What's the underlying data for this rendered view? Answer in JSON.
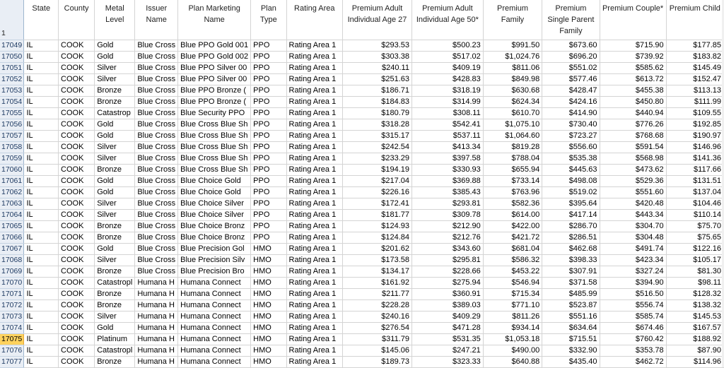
{
  "corner_row_label": "1",
  "columns": [
    "State",
    "County",
    "Metal Level",
    "Issuer Name",
    "Plan Marketing Name",
    "Plan Type",
    "Rating Area",
    "Premium Adult Individual Age 27",
    "Premium Adult Individual Age 50*",
    "Premium Family",
    "Premium Single Parent Family",
    "Premium Couple*",
    "Premium Child"
  ],
  "selected_row": "17075",
  "rows": [
    {
      "num": "17049",
      "cells": [
        "IL",
        "COOK",
        "Gold",
        "Blue Cross",
        "Blue PPO Gold 001",
        "PPO",
        "Rating Area 1",
        "$293.53",
        "$500.23",
        "$991.50",
        "$673.60",
        "$715.90",
        "$177.85"
      ]
    },
    {
      "num": "17050",
      "cells": [
        "IL",
        "COOK",
        "Gold",
        "Blue Cross",
        "Blue PPO Gold 002",
        "PPO",
        "Rating Area 1",
        "$303.38",
        "$517.02",
        "$1,024.76",
        "$696.20",
        "$739.92",
        "$183.82"
      ]
    },
    {
      "num": "17051",
      "cells": [
        "IL",
        "COOK",
        "Silver",
        "Blue Cross",
        "Blue PPO Silver 00",
        "PPO",
        "Rating Area 1",
        "$240.11",
        "$409.19",
        "$811.06",
        "$551.02",
        "$585.62",
        "$145.49"
      ]
    },
    {
      "num": "17052",
      "cells": [
        "IL",
        "COOK",
        "Silver",
        "Blue Cross",
        "Blue PPO Silver 00",
        "PPO",
        "Rating Area 1",
        "$251.63",
        "$428.83",
        "$849.98",
        "$577.46",
        "$613.72",
        "$152.47"
      ]
    },
    {
      "num": "17053",
      "cells": [
        "IL",
        "COOK",
        "Bronze",
        "Blue Cross",
        "Blue PPO Bronze (",
        "PPO",
        "Rating Area 1",
        "$186.71",
        "$318.19",
        "$630.68",
        "$428.47",
        "$455.38",
        "$113.13"
      ]
    },
    {
      "num": "17054",
      "cells": [
        "IL",
        "COOK",
        "Bronze",
        "Blue Cross",
        "Blue PPO Bronze (",
        "PPO",
        "Rating Area 1",
        "$184.83",
        "$314.99",
        "$624.34",
        "$424.16",
        "$450.80",
        "$111.99"
      ]
    },
    {
      "num": "17055",
      "cells": [
        "IL",
        "COOK",
        "Catastrop",
        "Blue Cross",
        "Blue Security PPO",
        "PPO",
        "Rating Area 1",
        "$180.79",
        "$308.11",
        "$610.70",
        "$414.90",
        "$440.94",
        "$109.55"
      ]
    },
    {
      "num": "17056",
      "cells": [
        "IL",
        "COOK",
        "Gold",
        "Blue Cross",
        "Blue Cross Blue Sh",
        "PPO",
        "Rating Area 1",
        "$318.28",
        "$542.41",
        "$1,075.10",
        "$730.40",
        "$776.26",
        "$192.85"
      ]
    },
    {
      "num": "17057",
      "cells": [
        "IL",
        "COOK",
        "Gold",
        "Blue Cross",
        "Blue Cross Blue Sh",
        "PPO",
        "Rating Area 1",
        "$315.17",
        "$537.11",
        "$1,064.60",
        "$723.27",
        "$768.68",
        "$190.97"
      ]
    },
    {
      "num": "17058",
      "cells": [
        "IL",
        "COOK",
        "Silver",
        "Blue Cross",
        "Blue Cross Blue Sh",
        "PPO",
        "Rating Area 1",
        "$242.54",
        "$413.34",
        "$819.28",
        "$556.60",
        "$591.54",
        "$146.96"
      ]
    },
    {
      "num": "17059",
      "cells": [
        "IL",
        "COOK",
        "Silver",
        "Blue Cross",
        "Blue Cross Blue Sh",
        "PPO",
        "Rating Area 1",
        "$233.29",
        "$397.58",
        "$788.04",
        "$535.38",
        "$568.98",
        "$141.36"
      ]
    },
    {
      "num": "17060",
      "cells": [
        "IL",
        "COOK",
        "Bronze",
        "Blue Cross",
        "Blue Cross Blue Sh",
        "PPO",
        "Rating Area 1",
        "$194.19",
        "$330.93",
        "$655.94",
        "$445.63",
        "$473.62",
        "$117.66"
      ]
    },
    {
      "num": "17061",
      "cells": [
        "IL",
        "COOK",
        "Gold",
        "Blue Cross",
        "Blue Choice Gold",
        "PPO",
        "Rating Area 1",
        "$217.04",
        "$369.88",
        "$733.14",
        "$498.08",
        "$529.36",
        "$131.51"
      ]
    },
    {
      "num": "17062",
      "cells": [
        "IL",
        "COOK",
        "Gold",
        "Blue Cross",
        "Blue Choice Gold",
        "PPO",
        "Rating Area 1",
        "$226.16",
        "$385.43",
        "$763.96",
        "$519.02",
        "$551.60",
        "$137.04"
      ]
    },
    {
      "num": "17063",
      "cells": [
        "IL",
        "COOK",
        "Silver",
        "Blue Cross",
        "Blue Choice Silver",
        "PPO",
        "Rating Area 1",
        "$172.41",
        "$293.81",
        "$582.36",
        "$395.64",
        "$420.48",
        "$104.46"
      ]
    },
    {
      "num": "17064",
      "cells": [
        "IL",
        "COOK",
        "Silver",
        "Blue Cross",
        "Blue Choice Silver",
        "PPO",
        "Rating Area 1",
        "$181.77",
        "$309.78",
        "$614.00",
        "$417.14",
        "$443.34",
        "$110.14"
      ]
    },
    {
      "num": "17065",
      "cells": [
        "IL",
        "COOK",
        "Bronze",
        "Blue Cross",
        "Blue Choice Bronz",
        "PPO",
        "Rating Area 1",
        "$124.93",
        "$212.90",
        "$422.00",
        "$286.70",
        "$304.70",
        "$75.70"
      ]
    },
    {
      "num": "17066",
      "cells": [
        "IL",
        "COOK",
        "Bronze",
        "Blue Cross",
        "Blue Choice Bronz",
        "PPO",
        "Rating Area 1",
        "$124.84",
        "$212.76",
        "$421.72",
        "$286.51",
        "$304.48",
        "$75.65"
      ]
    },
    {
      "num": "17067",
      "cells": [
        "IL",
        "COOK",
        "Gold",
        "Blue Cross",
        "Blue Precision Gol",
        "HMO",
        "Rating Area 1",
        "$201.62",
        "$343.60",
        "$681.04",
        "$462.68",
        "$491.74",
        "$122.16"
      ]
    },
    {
      "num": "17068",
      "cells": [
        "IL",
        "COOK",
        "Silver",
        "Blue Cross",
        "Blue Precision Silv",
        "HMO",
        "Rating Area 1",
        "$173.58",
        "$295.81",
        "$586.32",
        "$398.33",
        "$423.34",
        "$105.17"
      ]
    },
    {
      "num": "17069",
      "cells": [
        "IL",
        "COOK",
        "Bronze",
        "Blue Cross",
        "Blue Precision Bro",
        "HMO",
        "Rating Area 1",
        "$134.17",
        "$228.66",
        "$453.22",
        "$307.91",
        "$327.24",
        "$81.30"
      ]
    },
    {
      "num": "17070",
      "cells": [
        "IL",
        "COOK",
        "Catastropl",
        "Humana H",
        "Humana Connect",
        "HMO",
        "Rating Area 1",
        "$161.92",
        "$275.94",
        "$546.94",
        "$371.58",
        "$394.90",
        "$98.11"
      ]
    },
    {
      "num": "17071",
      "cells": [
        "IL",
        "COOK",
        "Bronze",
        "Humana H",
        "Humana Connect",
        "HMO",
        "Rating Area 1",
        "$211.77",
        "$360.91",
        "$715.34",
        "$485.99",
        "$516.50",
        "$128.32"
      ]
    },
    {
      "num": "17072",
      "cells": [
        "IL",
        "COOK",
        "Bronze",
        "Humana H",
        "Humana Connect",
        "HMO",
        "Rating Area 1",
        "$228.28",
        "$389.03",
        "$771.10",
        "$523.87",
        "$556.74",
        "$138.32"
      ]
    },
    {
      "num": "17073",
      "cells": [
        "IL",
        "COOK",
        "Silver",
        "Humana H",
        "Humana Connect",
        "HMO",
        "Rating Area 1",
        "$240.16",
        "$409.29",
        "$811.26",
        "$551.16",
        "$585.74",
        "$145.53"
      ]
    },
    {
      "num": "17074",
      "cells": [
        "IL",
        "COOK",
        "Gold",
        "Humana H",
        "Humana Connect",
        "HMO",
        "Rating Area 1",
        "$276.54",
        "$471.28",
        "$934.14",
        "$634.64",
        "$674.46",
        "$167.57"
      ]
    },
    {
      "num": "17075",
      "cells": [
        "IL",
        "COOK",
        "Platinum",
        "Humana H",
        "Humana Connect",
        "HMO",
        "Rating Area 1",
        "$311.79",
        "$531.35",
        "$1,053.18",
        "$715.51",
        "$760.42",
        "$188.92"
      ]
    },
    {
      "num": "17076",
      "cells": [
        "IL",
        "COOK",
        "Catastropl",
        "Humana H",
        "Humana Connect",
        "HMO",
        "Rating Area 1",
        "$145.06",
        "$247.21",
        "$490.00",
        "$332.90",
        "$353.78",
        "$87.90"
      ]
    },
    {
      "num": "17077",
      "cells": [
        "IL",
        "COOK",
        "Bronze",
        "Humana H",
        "Humana Connect",
        "HMO",
        "Rating Area 1",
        "$189.73",
        "$323.33",
        "$640.88",
        "$435.40",
        "$462.72",
        "$114.96"
      ]
    }
  ]
}
